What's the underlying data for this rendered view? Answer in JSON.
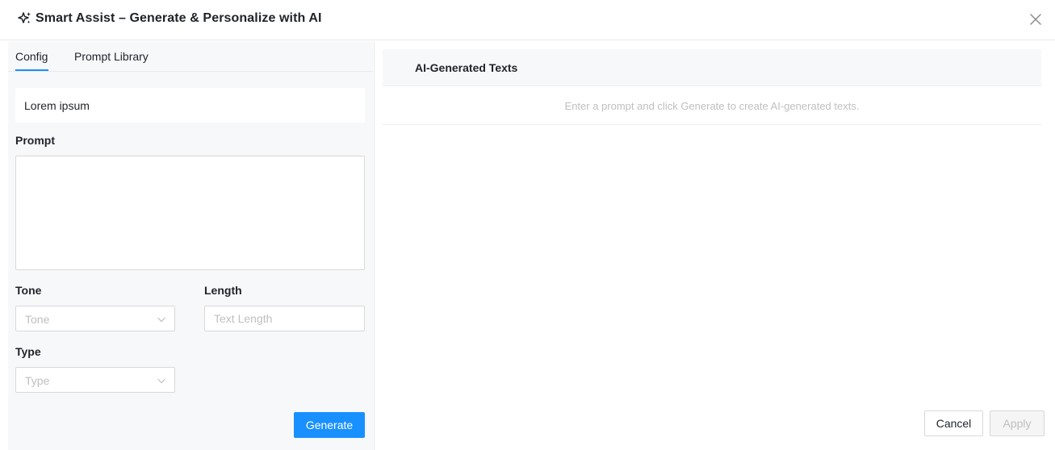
{
  "header": {
    "title": "Smart Assist – Generate & Personalize with AI",
    "icon": "sparkle-icon",
    "close_icon": "close-icon"
  },
  "tabs": [
    {
      "label": "Config",
      "active": true
    },
    {
      "label": "Prompt Library",
      "active": false
    }
  ],
  "config": {
    "name_value": "Lorem ipsum",
    "prompt_label": "Prompt",
    "prompt_value": "",
    "tone_label": "Tone",
    "tone_placeholder": "Tone",
    "length_label": "Length",
    "length_placeholder": "Text Length",
    "type_label": "Type",
    "type_placeholder": "Type",
    "generate_label": "Generate"
  },
  "results": {
    "header": "AI-Generated Texts",
    "empty_message": "Enter a prompt and click Generate to create AI-generated texts."
  },
  "footer": {
    "cancel_label": "Cancel",
    "apply_label": "Apply",
    "apply_disabled": true
  },
  "colors": {
    "primary": "#1890ff",
    "panel_bg": "#f7f8fa",
    "border": "#d9d9d9",
    "placeholder": "#bfbfbf"
  }
}
